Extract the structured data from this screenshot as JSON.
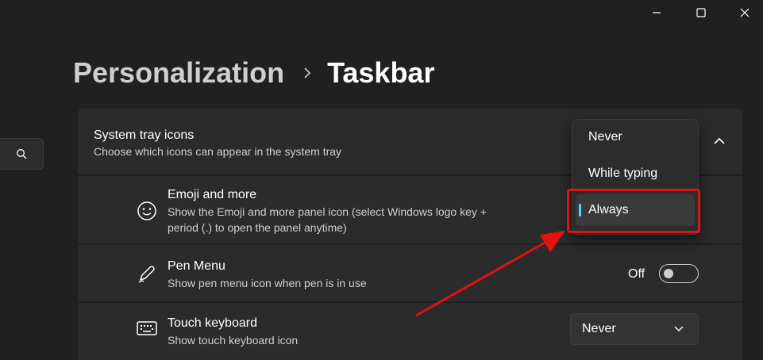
{
  "window_controls": {
    "minimize": "minimize-icon",
    "maximize": "maximize-icon",
    "close": "close-icon"
  },
  "breadcrumb": {
    "parent": "Personalization",
    "current": "Taskbar"
  },
  "search": {
    "icon": "search-icon"
  },
  "system_tray": {
    "title": "System tray icons",
    "description": "Choose which icons can appear in the system tray",
    "collapse_icon": "chevron-up-icon"
  },
  "rows": [
    {
      "title": "Emoji and more",
      "description_line1": "Show the Emoji and more panel icon (select Windows logo key +",
      "description_line2": "period (.) to open the panel anytime)",
      "icon": "emoji-icon"
    },
    {
      "title": "Pen Menu",
      "description": "Show pen menu icon when pen is in use",
      "icon": "pen-icon",
      "toggle_label": "Off",
      "toggle_on": false
    },
    {
      "title": "Touch keyboard",
      "description": "Show touch keyboard icon",
      "icon": "keyboard-icon",
      "dropdown_value": "Never"
    }
  ],
  "flyout": {
    "options": [
      "Never",
      "While typing",
      "Always"
    ],
    "selected": "Always"
  },
  "colors": {
    "background": "#202020",
    "card": "#2b2b2b",
    "accent": "#60cdff",
    "annotation": "#e11212"
  }
}
